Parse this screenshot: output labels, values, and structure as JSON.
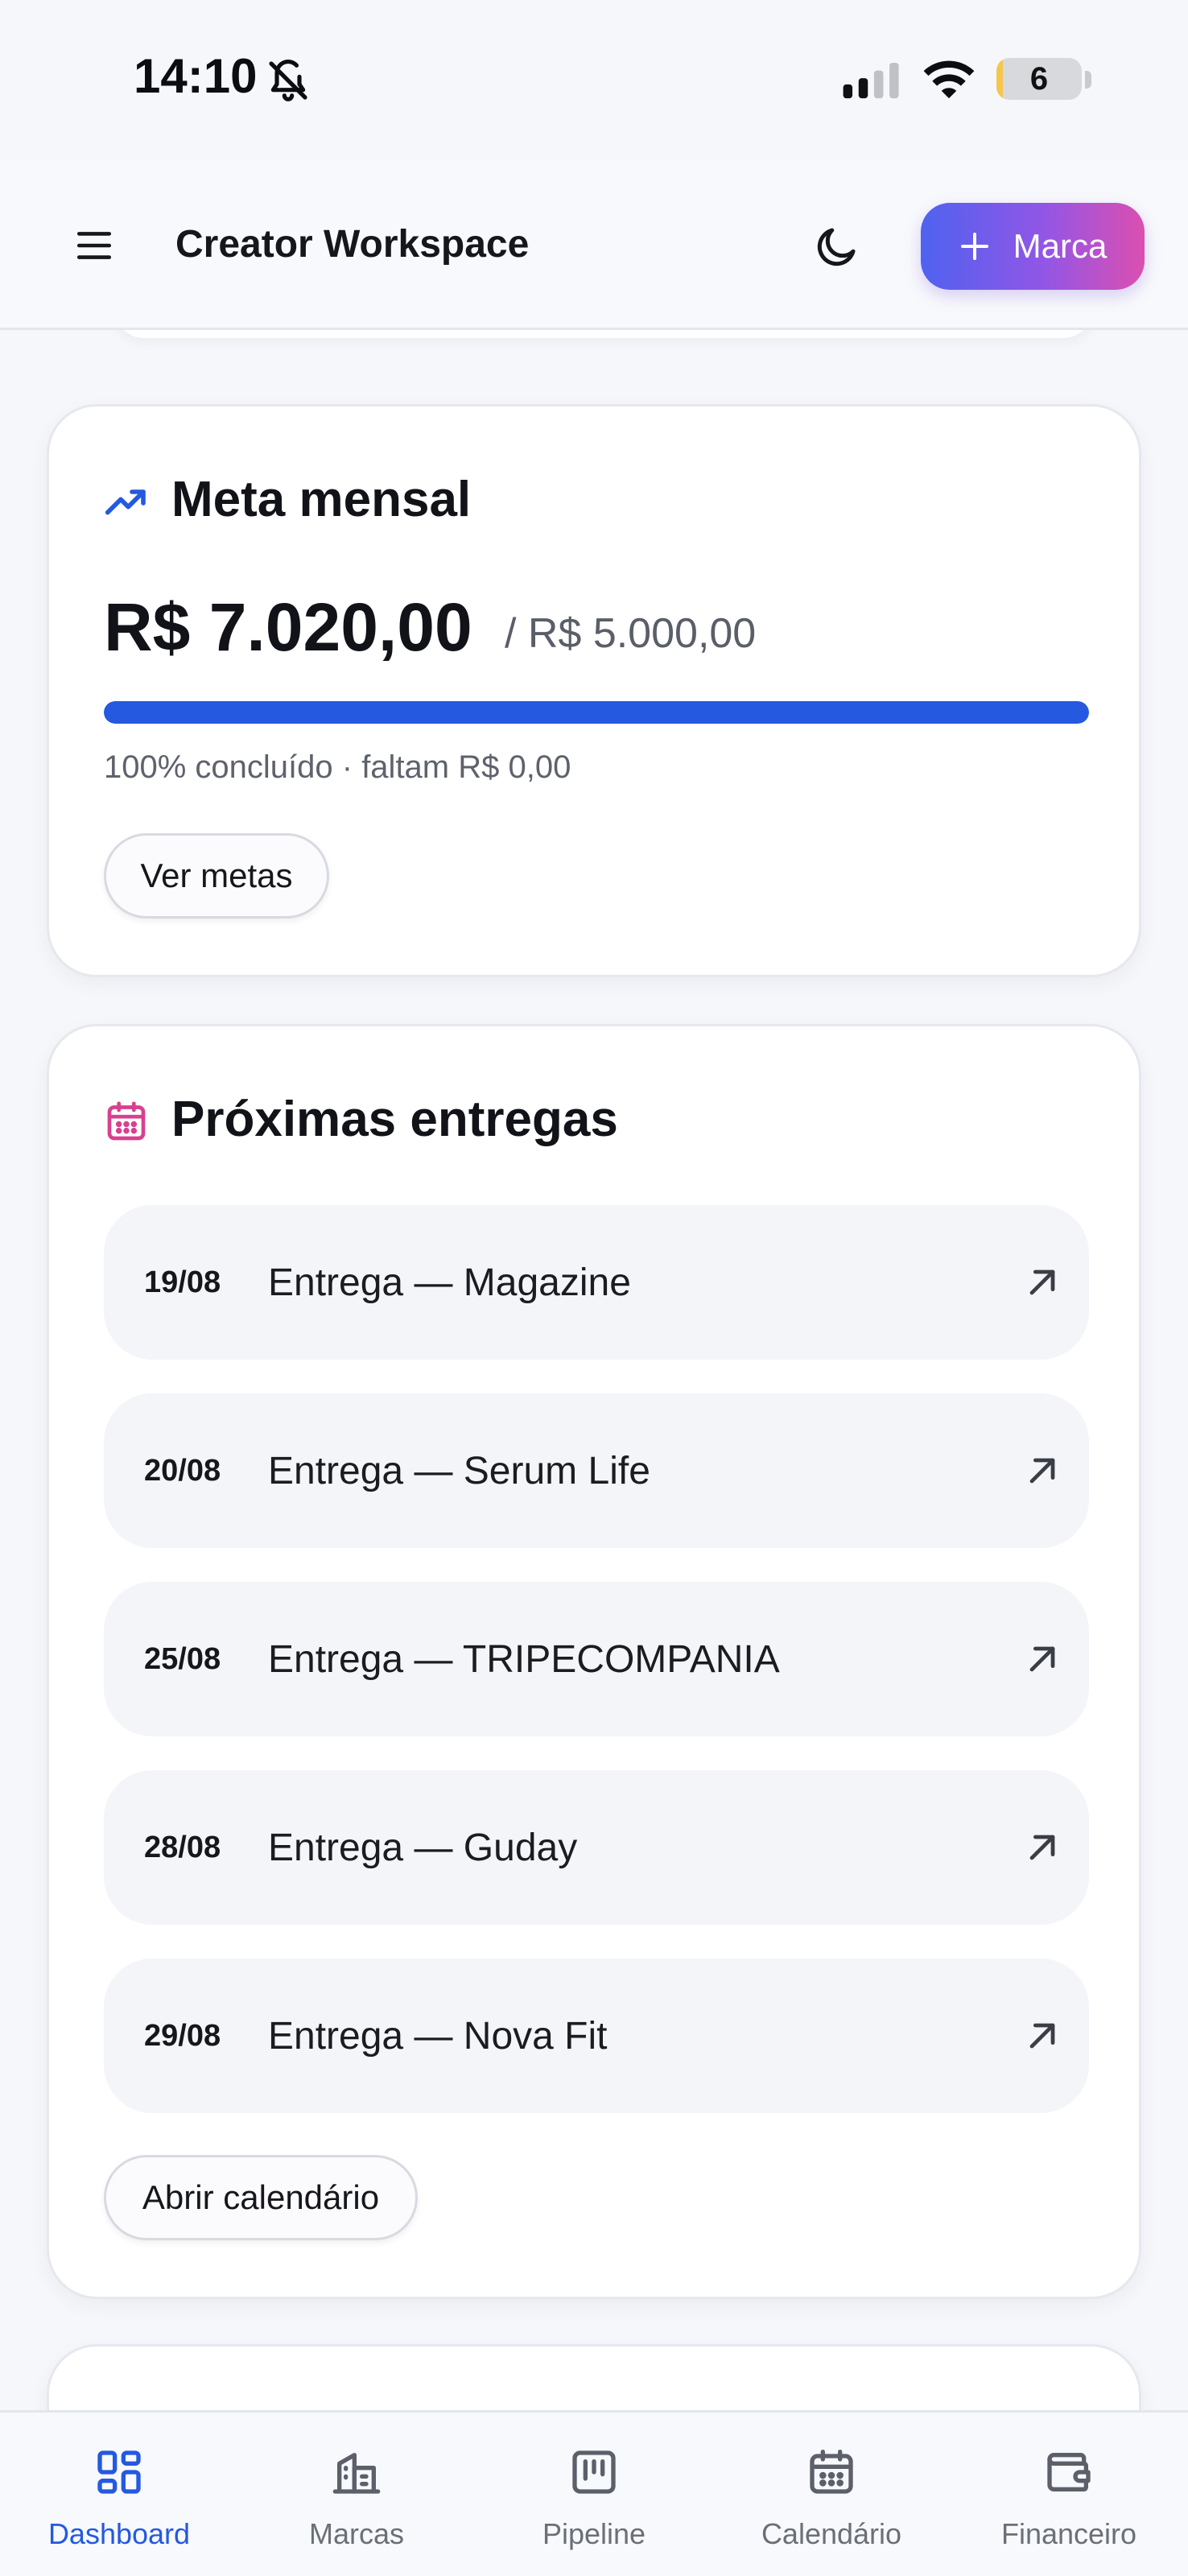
{
  "status_bar": {
    "time": "14:10",
    "battery": "6",
    "battery_level_percent": 6
  },
  "header": {
    "title": "Creator Workspace",
    "add_brand_label": "Marca"
  },
  "goal_card": {
    "title": "Meta mensal",
    "amount": "R$ 7.020,00",
    "target": "/ R$ 5.000,00",
    "progress_percent": 100,
    "status": "100% concluído · faltam R$ 0,00",
    "button_label": "Ver metas"
  },
  "deliveries_card": {
    "title": "Próximas entregas",
    "items": [
      {
        "date": "19/08",
        "name": "Entrega — Magazine"
      },
      {
        "date": "20/08",
        "name": "Entrega — Serum Life"
      },
      {
        "date": "25/08",
        "name": "Entrega — TRIPECOMPANIA"
      },
      {
        "date": "28/08",
        "name": "Entrega — Guday"
      },
      {
        "date": "29/08",
        "name": "Entrega — Nova Fit"
      }
    ],
    "button_label": "Abrir calendário"
  },
  "bottom_nav": {
    "items": [
      {
        "label": "Dashboard",
        "icon": "dashboard-icon",
        "active": true
      },
      {
        "label": "Marcas",
        "icon": "building-icon",
        "active": false
      },
      {
        "label": "Pipeline",
        "icon": "kanban-icon",
        "active": false
      },
      {
        "label": "Calendário",
        "icon": "calendar-icon",
        "active": false
      },
      {
        "label": "Financeiro",
        "icon": "wallet-icon",
        "active": false
      }
    ]
  },
  "colors": {
    "accent": "#2459e0",
    "gradient_start": "#4f62f0",
    "gradient_end": "#db4fb0",
    "calendar_accent": "#d9408f"
  }
}
